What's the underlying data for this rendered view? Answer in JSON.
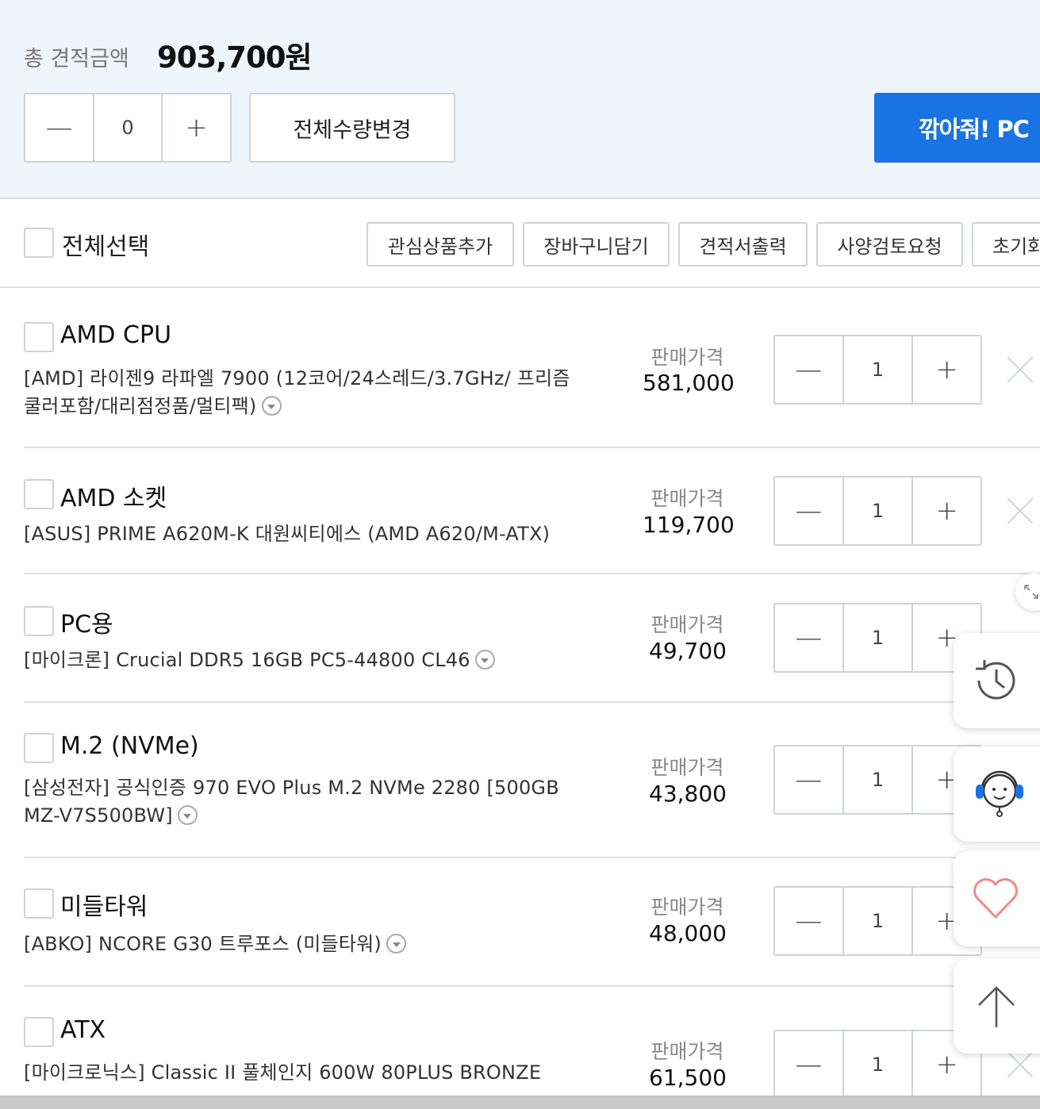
{
  "summary": {
    "total_label": "총 견적금액",
    "total_value": "903,700원",
    "quantity": "0",
    "change_all_label": "전체수량변경",
    "discount_button_label": "깎아줘! PC"
  },
  "toolbar": {
    "select_all_label": "전체선택",
    "buttons": [
      "관심상품추가",
      "장바구니담기",
      "견적서출력",
      "사양검토요청",
      "초기화"
    ]
  },
  "price_label": "판매가격",
  "products": [
    {
      "category": "AMD CPU",
      "description": "[AMD] 라이젠9 라파엘 7900 (12코어/24스레드/3.7GHz/ 프리즘쿨러포함/대리점정품/멀티팩)",
      "price": "581,000",
      "quantity": "1"
    },
    {
      "category": "AMD 소켓",
      "description": "[ASUS] PRIME A620M-K 대원씨티에스 (AMD A620/M-ATX)",
      "price": "119,700",
      "quantity": "1"
    },
    {
      "category": "PC용",
      "description": "[마이크론] Crucial DDR5 16GB PC5-44800 CL46",
      "price": "49,700",
      "quantity": "1"
    },
    {
      "category": "M.2 (NVMe)",
      "description": "[삼성전자] 공식인증 970 EVO Plus M.2 NVMe 2280 [500GB MZ-V7S500BW]",
      "price": "43,800",
      "quantity": "1"
    },
    {
      "category": "미들타워",
      "description": "[ABKO] NCORE G30 트루포스 (미들타워)",
      "price": "48,000",
      "quantity": "1"
    },
    {
      "category": "ATX",
      "description": "[마이크로닉스] Classic II 풀체인지 600W 80PLUS BRONZE",
      "price": "61,500",
      "quantity": "1"
    }
  ],
  "floating": {
    "icons": [
      "history-icon",
      "customer-support-icon",
      "heart-icon",
      "arrow-up-icon"
    ]
  },
  "colors": {
    "accent": "#1a73e2",
    "summary_bg": "#eef5fc",
    "border": "#cfd3d8",
    "heart": "#f08a8a"
  }
}
